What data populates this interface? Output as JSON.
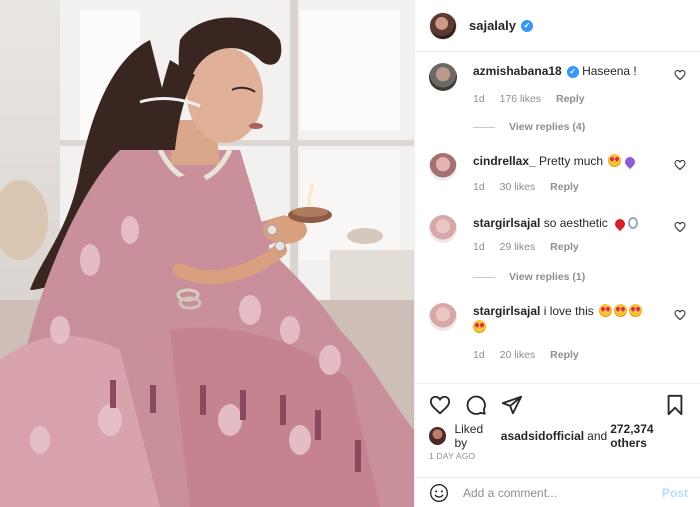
{
  "post": {
    "username": "sajalaly",
    "verified": true
  },
  "comments": [
    {
      "username": "azmishabana18",
      "verified": true,
      "text": "Haseena !",
      "age": "1d",
      "likes": "176 likes",
      "reply": "Reply",
      "view_replies": "View replies (4)"
    },
    {
      "username": "cindrellax_",
      "text": "Pretty much",
      "emojis": [
        "smiling-face-with-heart-eyes",
        "purple-heart"
      ],
      "age": "1d",
      "likes": "30 likes",
      "reply": "Reply"
    },
    {
      "username": "stargirlsajal",
      "text": "so aesthetic",
      "emojis": [
        "red-heart",
        "ring"
      ],
      "age": "1d",
      "likes": "29 likes",
      "reply": "Reply",
      "view_replies": "View replies (1)"
    },
    {
      "username": "stargirlsajal",
      "text": "i love this",
      "emojis": [
        "smiling-face-with-heart-eyes",
        "smiling-face-with-heart-eyes",
        "smiling-face-with-heart-eyes",
        "smiling-face-with-heart-eyes"
      ],
      "age": "1d",
      "likes": "20 likes",
      "reply": "Reply"
    }
  ],
  "actions": {
    "icons": [
      "heart-icon",
      "comment-icon",
      "share-icon",
      "bookmark-icon"
    ]
  },
  "likes": {
    "prefix": "Liked by",
    "liker": "asadsidofficial",
    "conjunction": "and",
    "others": "272,374 others"
  },
  "timestamp": "1 DAY AGO",
  "add_comment": {
    "placeholder": "Add a comment...",
    "post_label": "Post"
  },
  "colors": {
    "accent_blue": "#3897f0",
    "muted_text": "#8e8e8e",
    "post_disabled": "#b2dffc"
  }
}
